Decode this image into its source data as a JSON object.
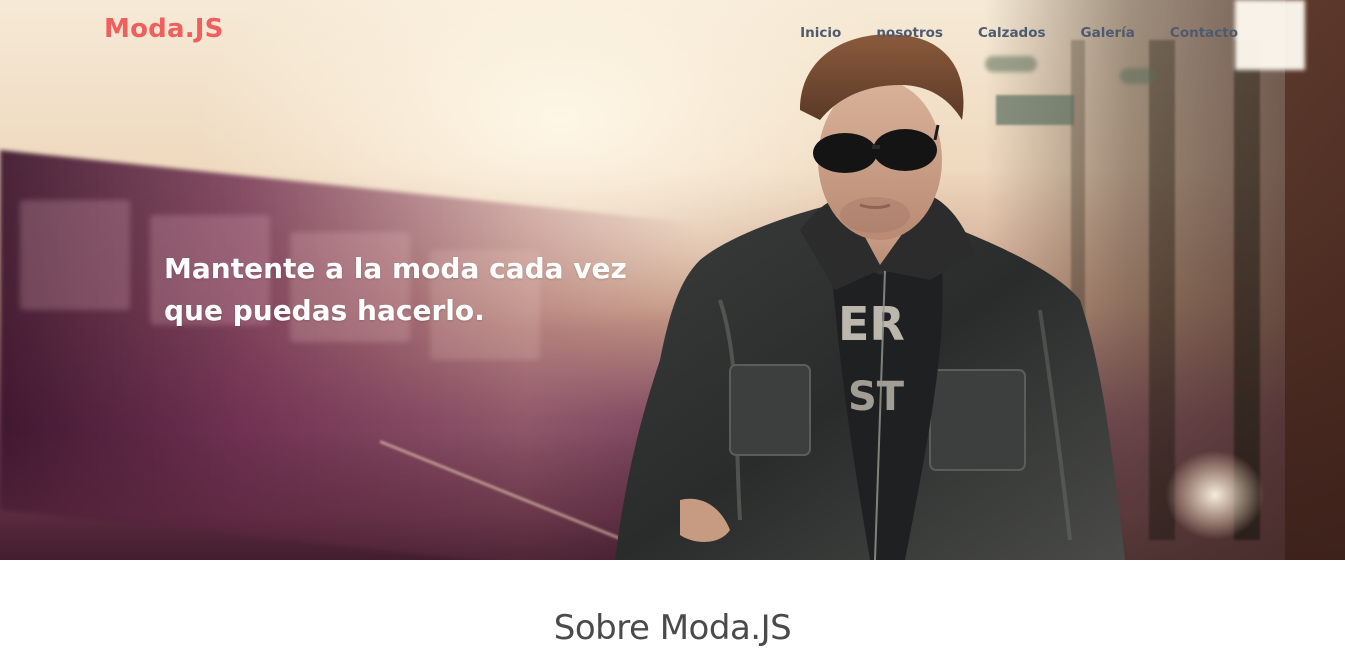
{
  "brand": {
    "name": "Moda.JS",
    "color": "#f05f5f"
  },
  "nav": {
    "items": [
      {
        "label": "Inicio"
      },
      {
        "label": "nosotros"
      },
      {
        "label": "Calzados"
      },
      {
        "label": "Galería"
      },
      {
        "label": "Contacto"
      }
    ],
    "color": "#4e5a6e"
  },
  "hero": {
    "headline": "Mantente a la moda cada vez que puedas hacerlo.",
    "image": "man-in-leather-jacket-train-station"
  },
  "about": {
    "title": "Sobre Moda.JS"
  }
}
